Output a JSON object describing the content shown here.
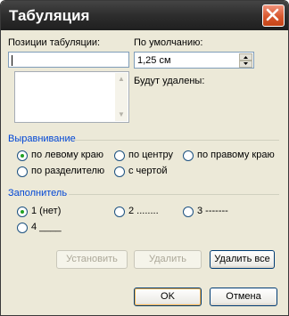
{
  "window": {
    "title": "Табуляция"
  },
  "tab_positions": {
    "label": "Позиции табуляции:",
    "value": ""
  },
  "default_tabs": {
    "label": "По умолчанию:",
    "value": "1,25 см"
  },
  "to_clear": {
    "label": "Будут удалены:"
  },
  "alignment": {
    "title": "Выравнивание",
    "options": [
      {
        "label": "по левому краю",
        "selected": true
      },
      {
        "label": "по центру",
        "selected": false
      },
      {
        "label": "по правому краю",
        "selected": false
      },
      {
        "label": "по разделителю",
        "selected": false
      },
      {
        "label": "с чертой",
        "selected": false
      }
    ]
  },
  "leader": {
    "title": "Заполнитель",
    "options": [
      {
        "label": "1 (нет)",
        "selected": true
      },
      {
        "label": "2 ........",
        "selected": false
      },
      {
        "label": "3 -------",
        "selected": false
      },
      {
        "label": "4 ____",
        "selected": false
      }
    ]
  },
  "buttons": {
    "set": "Установить",
    "clear": "Удалить",
    "clear_all": "Удалить все",
    "ok": "OK",
    "cancel": "Отмена"
  }
}
